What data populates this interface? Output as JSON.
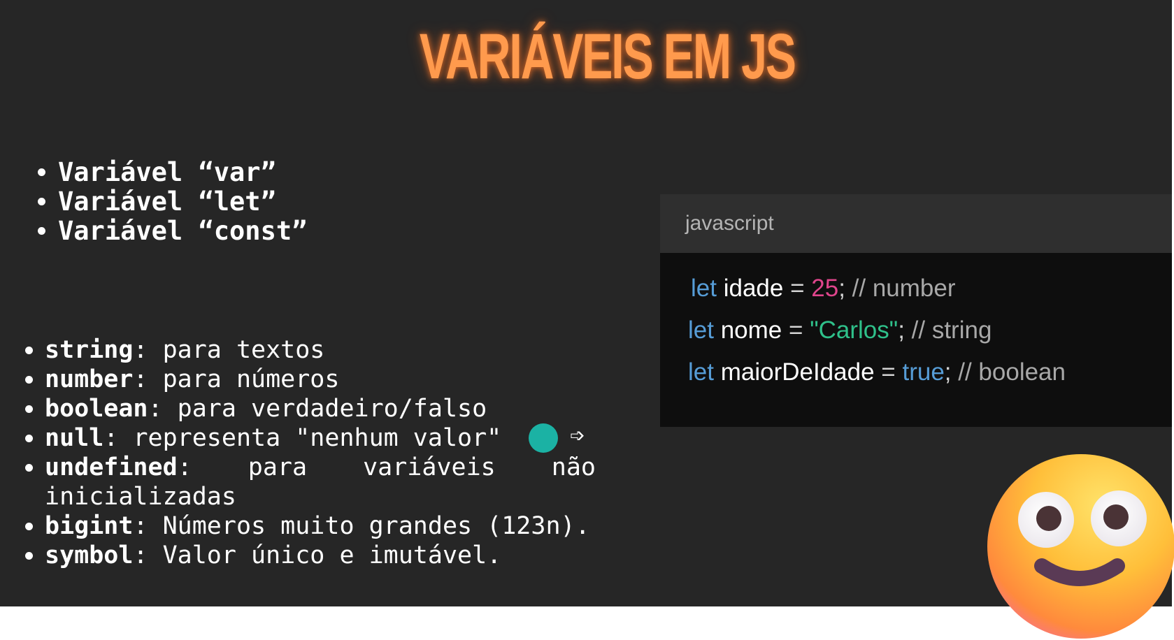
{
  "slide": {
    "title": "VARIÁVEIS EM JS",
    "accent_color": "#ff9a4d",
    "background_color": "#262626",
    "variable_kinds": [
      {
        "label": "Variável “var”"
      },
      {
        "label": "Variável “let”"
      },
      {
        "label": "Variável “const”"
      }
    ],
    "data_types": [
      {
        "name": "string",
        "description": ": para textos"
      },
      {
        "name": "number",
        "description": ": para números"
      },
      {
        "name": "boolean",
        "description": ": para verdadeiro/falso"
      },
      {
        "name": "null",
        "description": ": representa \"nenhum valor\""
      },
      {
        "name": "undefined",
        "description": ": para variáveis não inicializadas"
      },
      {
        "name": "bigint",
        "description": ": Números muito grandes (123n)."
      },
      {
        "name": "symbol",
        "description": ": Valor único e imutável."
      }
    ]
  },
  "code_panel": {
    "language": "javascript",
    "lines": [
      {
        "keyword": "let",
        "identifier": "idade",
        "operator": "=",
        "value": "25",
        "value_type": "number",
        "terminator": ";",
        "comment": "// number"
      },
      {
        "keyword": "let",
        "identifier": "nome",
        "operator": "=",
        "value": "\"Carlos\"",
        "value_type": "string",
        "terminator": ";",
        "comment": "// string"
      },
      {
        "keyword": "let",
        "identifier": "maiorDeIdade",
        "operator": "=",
        "value": "true",
        "value_type": "boolean",
        "terminator": ";",
        "comment": "// boolean"
      }
    ]
  },
  "cursor": {
    "highlight_color": "#1abeaf",
    "icon": "pointer-arrow-icon",
    "glyph": "➩"
  },
  "decoration": {
    "icon": "smiling-face-emoji"
  }
}
